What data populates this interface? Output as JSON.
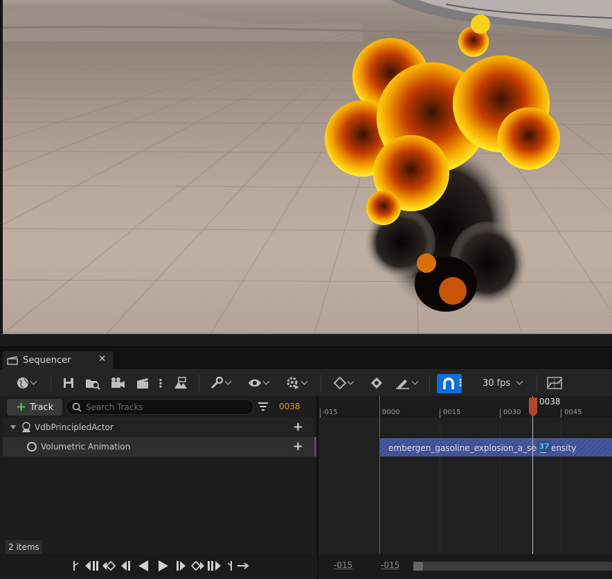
{
  "tab": {
    "title": "Sequencer",
    "close_icon": "close-icon"
  },
  "toolbar": {
    "fps_label": "30 fps",
    "icons": [
      "world-icon",
      "save-icon",
      "find-asset-icon",
      "camera-icon",
      "clapper-icon",
      "more-vertical-icon",
      "render-movie-icon",
      "wrench-icon",
      "eye-icon",
      "gear-icon",
      "key-icon",
      "auto-key-icon",
      "brush-icon",
      "snap-magnet-icon",
      "curve-editor-icon"
    ],
    "snap_color": "#0f6fd6"
  },
  "tracks": {
    "add_track_label": "Track",
    "search_placeholder": "Search Tracks",
    "current_frame": "0038",
    "rows": [
      {
        "label": "VdbPrincipledActor"
      },
      {
        "label": "Volumetric Animation"
      }
    ],
    "items_count": "2 items"
  },
  "timeline": {
    "ticks": [
      "-015",
      "0000",
      "0015",
      "0030",
      "0045"
    ],
    "playhead_label": "0038",
    "section_label": "embergen_gasoline_explosion_a_seq_density",
    "key_badge": "37",
    "view_start": "-015",
    "view_end": "-015"
  },
  "colors": {
    "current_frame": "#e69a1e",
    "playhead": "#b5452e",
    "start_marker": "#1f8e2a",
    "section": "#4252a0"
  }
}
